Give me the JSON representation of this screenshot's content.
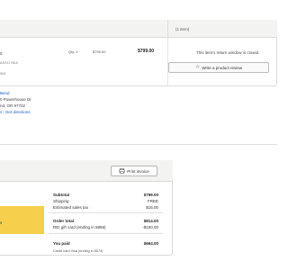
{
  "order_card": {
    "header_text": "(1 item)",
    "item_mark": "s",
    "item_subtitle_1": "ASSO SEA",
    "item_subtitle_2": "003",
    "qty": "Qty. 1",
    "unit_price": "$799.00",
    "line_price": "$799.00",
    "return_notice": "This item's return window is closed",
    "review_button": "Write a product review"
  },
  "store": {
    "name": "Bend",
    "address_line1": "0 Powerhouse Dr",
    "address_line2": "nd, OR 97702",
    "links_prefix": "s",
    "links_separator": " | ",
    "directions": "Get directions"
  },
  "payment": {
    "print_button": "Print invoice",
    "yellow_text": "s",
    "subtotal_label": "Subtotal",
    "subtotal_value": "$799.00",
    "shipping_label": "Shipping",
    "shipping_value": "FREE",
    "tax_label": "Estimated sales tax",
    "tax_value": "$15.00",
    "order_total_label": "Order total",
    "order_total_value": "$814.00",
    "gift_card_label": "REI gift card (ending in 5859)",
    "gift_card_value": "-$150.00",
    "you_paid_label": "You paid",
    "you_paid_value": "$664.00",
    "card_label": "Credit card Visa (ending in 8574)"
  }
}
